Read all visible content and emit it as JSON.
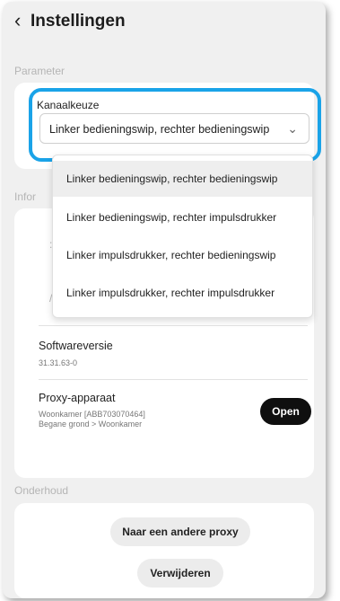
{
  "header": {
    "back_icon": "‹",
    "title": "Instellingen"
  },
  "parameter": {
    "section_label": "Parameter",
    "field_label": "Kanaalkeuze",
    "selected_value": "Linker bedieningswip, rechter bedieningswip",
    "options": [
      "Linker bedieningswip, rechter bedieningswip",
      "Linker bedieningswip, rechter impulsdrukker",
      "Linker impulsdrukker, rechter bedieningswip",
      "Linker impulsdrukker, rechter impulsdrukker"
    ]
  },
  "info": {
    "section_label_partial": "Infor",
    "software_title": "Softwareversie",
    "software_value": "31.31.63-0",
    "proxy_title": "Proxy-apparaat",
    "proxy_line1": "Woonkamer [ABB703070464]",
    "proxy_line2": "Begane grond > Woonkamer",
    "open_label": "Open"
  },
  "maintenance": {
    "section_label": "Onderhoud",
    "other_proxy_label": "Naar een andere proxy",
    "delete_label": "Verwijderen"
  },
  "colors": {
    "highlight": "#1aa3e8",
    "open_button": "#0f0f0f"
  }
}
